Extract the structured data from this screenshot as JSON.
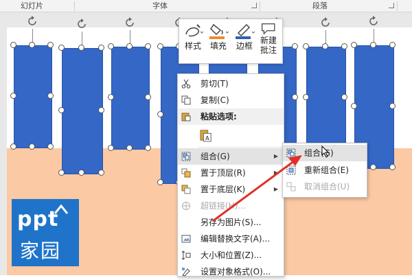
{
  "ribbon": {
    "groups": [
      "幻灯片",
      "字体",
      "段落"
    ]
  },
  "logo": {
    "line1": "ppt",
    "line2": "家园"
  },
  "mini_toolbar": {
    "style": "样式",
    "fill": "填充",
    "border": "边框",
    "new_comment_1": "新建",
    "new_comment_2": "批注"
  },
  "context_menu": {
    "items": [
      {
        "label": "剪切(T)",
        "icon": "scissors-icon"
      },
      {
        "label": "复制(C)",
        "icon": "copy-icon"
      },
      {
        "label": "粘贴选项:",
        "icon": "paste-icon"
      },
      {
        "label": "",
        "icon": "paste-keep-text-icon"
      },
      {
        "label": "组合(G)",
        "icon": "group-icon"
      },
      {
        "label": "置于顶层(R)",
        "icon": "bring-to-front-icon"
      },
      {
        "label": "置于底层(K)",
        "icon": "send-to-back-icon"
      },
      {
        "label": "超链接(H)...",
        "icon": "hyperlink-icon"
      },
      {
        "label": "另存为图片(S)...",
        "icon": ""
      },
      {
        "label": "编辑替换文字(A)...",
        "icon": "alt-text-icon"
      },
      {
        "label": "大小和位置(Z)...",
        "icon": "size-position-icon"
      },
      {
        "label": "设置对象格式(O)...",
        "icon": "format-object-icon"
      }
    ]
  },
  "submenu": {
    "items": [
      {
        "label": "组合(G)",
        "icon": "group-icon"
      },
      {
        "label": "重新组合(E)",
        "icon": "regroup-icon"
      },
      {
        "label": "取消组合(U)",
        "icon": "ungroup-icon"
      }
    ]
  },
  "colors": {
    "bar": "#3467c6",
    "slide_bg": "#fbc9a3",
    "logo": "#1f74c9",
    "arrow": "#e0302a",
    "fill_swatch": "#f0892a",
    "border_swatch": "#2e5fb8"
  }
}
